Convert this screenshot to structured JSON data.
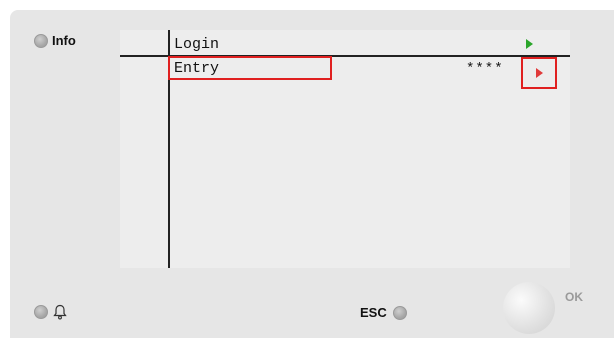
{
  "panel": {
    "info_label": "Info",
    "esc_label": "ESC",
    "ok_label": "OK"
  },
  "screen": {
    "rows": [
      {
        "label": "Login",
        "value": "",
        "arrow": "arrow-right-icon",
        "arrow_color": "#2aa52a"
      },
      {
        "label": "Entry",
        "value": "****",
        "arrow": "arrow-right-icon",
        "arrow_color": "#e03a3a"
      }
    ]
  },
  "icons": {
    "bell": "bell-icon"
  },
  "colors": {
    "device_bg": "#e6e6e6",
    "screen_bg": "#ededed",
    "highlight": "#e02020"
  }
}
